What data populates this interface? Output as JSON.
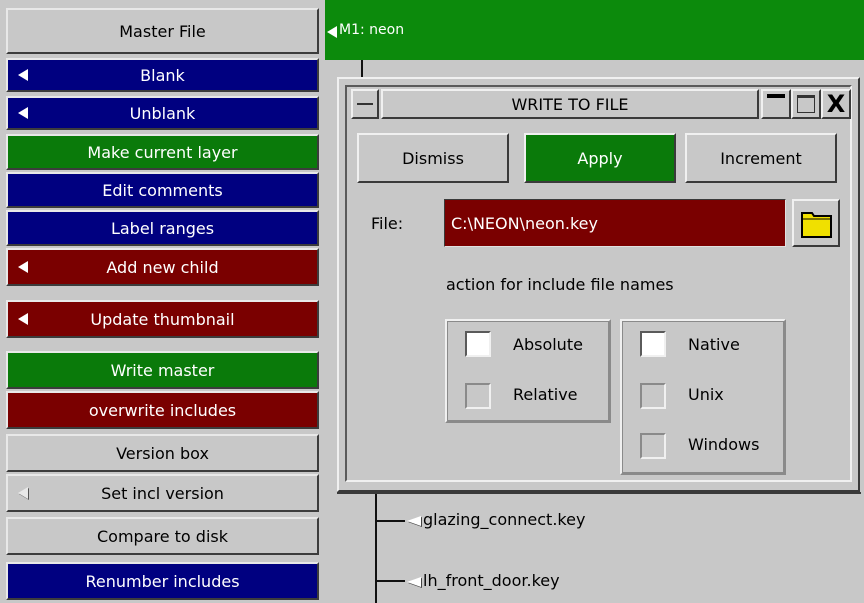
{
  "left_panel": {
    "title": "Master File",
    "buttons": [
      {
        "label": "Blank",
        "color": "#000080"
      },
      {
        "label": "Unblank",
        "color": "#000080"
      },
      {
        "label": "Make current layer",
        "color": "#0a7a0a"
      },
      {
        "label": "Edit comments",
        "color": "#000080"
      },
      {
        "label": "Label ranges",
        "color": "#000080"
      },
      {
        "label": "Add new child",
        "color": "#7a0000"
      },
      {
        "label": "Update thumbnail",
        "color": "#7a0000"
      },
      {
        "label": "Write master",
        "color": "#0a7a0a"
      },
      {
        "label": "overwrite includes",
        "color": "#7a0000"
      },
      {
        "label": "Version box",
        "color": "#c8c8c8"
      },
      {
        "label": "Set incl version",
        "color": "#c8c8c8"
      },
      {
        "label": "Compare to disk",
        "color": "#c8c8c8"
      },
      {
        "label": "Renumber includes",
        "color": "#000080"
      }
    ]
  },
  "tree": {
    "header_label": "M1: neon",
    "header_color": "#0c8a0c",
    "items": [
      {
        "label": "glazing_connect.key"
      },
      {
        "label": "lh_front_door.key"
      }
    ]
  },
  "dialog": {
    "title": "WRITE TO FILE",
    "close_glyph": "X",
    "buttons": {
      "dismiss": "Dismiss",
      "apply": "Apply",
      "increment": "Increment"
    },
    "file_label": "File:",
    "file_value": "C:\\NEON\\neon.key",
    "action_label": "action for include file names",
    "path_type_options": [
      {
        "label": "Absolute",
        "checked": true
      },
      {
        "label": "Relative",
        "checked": false
      }
    ],
    "os_options": [
      {
        "label": "Native",
        "checked": true
      },
      {
        "label": "Unix",
        "checked": false
      },
      {
        "label": "Windows",
        "checked": false
      }
    ]
  }
}
